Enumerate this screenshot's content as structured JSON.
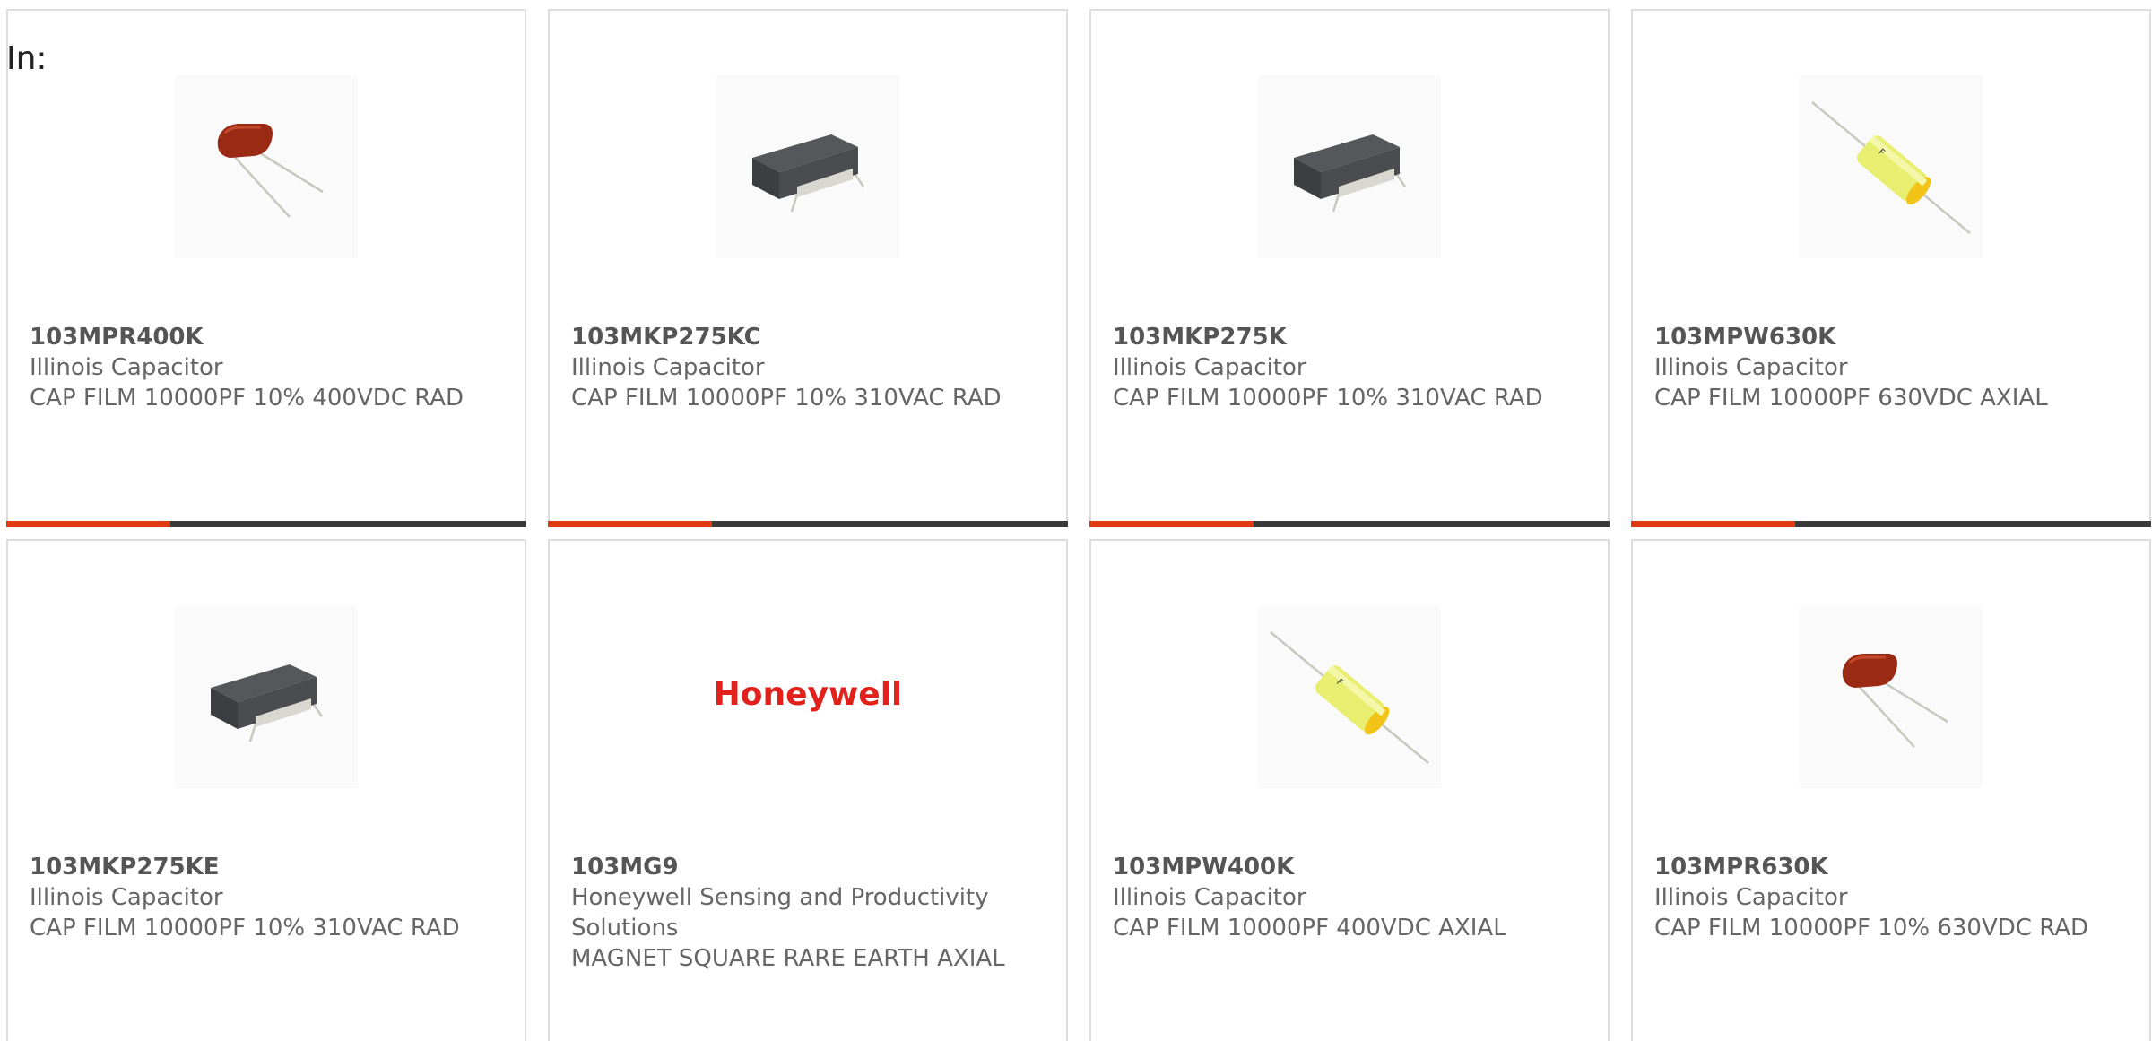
{
  "filter_label": "In:",
  "colors": {
    "accent": "#e03a10",
    "bar_dark": "#3a3a3a",
    "card_border": "#dddddd",
    "text": "#666666",
    "brand_red": "#e1221c"
  },
  "products": [
    {
      "part_number": "103MPR400K",
      "manufacturer": "Illinois Capacitor",
      "description": "CAP FILM 10000PF 10% 400VDC RAD",
      "image_icon": "red-film-capacitor-radial"
    },
    {
      "part_number": "103MKP275KC",
      "manufacturer": "Illinois Capacitor",
      "description": "CAP FILM 10000PF 10% 310VAC RAD",
      "image_icon": "gray-box-capacitor"
    },
    {
      "part_number": "103MKP275K",
      "manufacturer": "Illinois Capacitor",
      "description": "CAP FILM 10000PF 10% 310VAC RAD",
      "image_icon": "gray-box-capacitor"
    },
    {
      "part_number": "103MPW630K",
      "manufacturer": "Illinois Capacitor",
      "description": "CAP FILM 10000PF 630VDC AXIAL",
      "image_icon": "yellow-axial-capacitor"
    },
    {
      "part_number": "103MKP275KE",
      "manufacturer": "Illinois Capacitor",
      "description": "CAP FILM 10000PF 10% 310VAC RAD",
      "image_icon": "gray-box-capacitor"
    },
    {
      "part_number": "103MG9",
      "manufacturer": "Honeywell Sensing and Productivity Solutions",
      "description": "MAGNET SQUARE RARE EARTH AXIAL",
      "image_icon": "honeywell-logo",
      "logo_text": "Honeywell"
    },
    {
      "part_number": "103MPW400K",
      "manufacturer": "Illinois Capacitor",
      "description": "CAP FILM 10000PF 400VDC AXIAL",
      "image_icon": "yellow-axial-capacitor"
    },
    {
      "part_number": "103MPR630K",
      "manufacturer": "Illinois Capacitor",
      "description": "CAP FILM 10000PF 10% 630VDC RAD",
      "image_icon": "red-film-capacitor-radial"
    }
  ]
}
